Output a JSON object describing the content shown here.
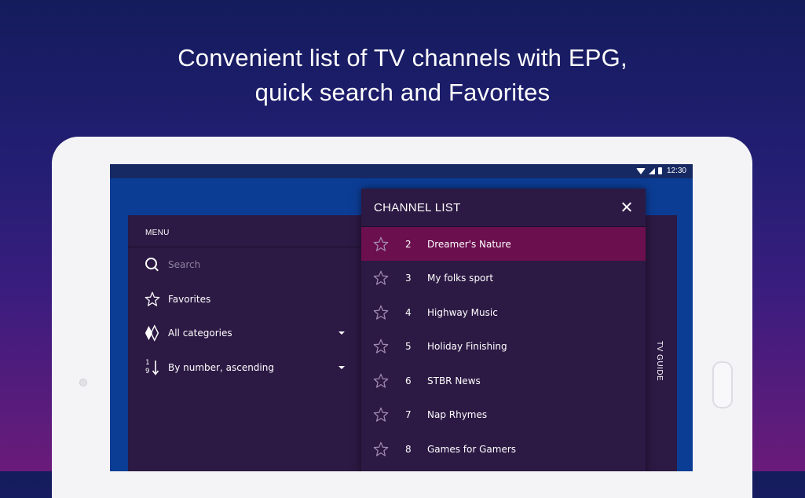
{
  "promo": {
    "line1": "Convenient list of TV channels with EPG,",
    "line2": "quick search and Favorites"
  },
  "statusbar": {
    "time": "12:30",
    "icons": [
      "wifi-icon",
      "signal-icon",
      "battery-icon"
    ]
  },
  "menu": {
    "title": "MENU",
    "search_placeholder": "Search",
    "favorites_label": "Favorites",
    "category_label": "All categories",
    "sort_label": "By number, ascending",
    "sort_icon_top": "1",
    "sort_icon_bottom": "9"
  },
  "channel_list": {
    "title": "CHANNEL LIST",
    "selected_color": "#6c0f4f",
    "channels": [
      {
        "number": "2",
        "name": "Dreamer's Nature"
      },
      {
        "number": "3",
        "name": "My folks sport"
      },
      {
        "number": "4",
        "name": "Highway Music"
      },
      {
        "number": "5",
        "name": "Holiday Finishing"
      },
      {
        "number": "6",
        "name": "STBR News"
      },
      {
        "number": "7",
        "name": "Nap Rhymes"
      },
      {
        "number": "8",
        "name": "Games for Gamers"
      }
    ]
  },
  "tv_guide": {
    "label": "TV GUIDE"
  },
  "colors": {
    "panel": "#2c1944",
    "screen_bg": "#0c3d95",
    "accent": "#6c0f4f"
  }
}
